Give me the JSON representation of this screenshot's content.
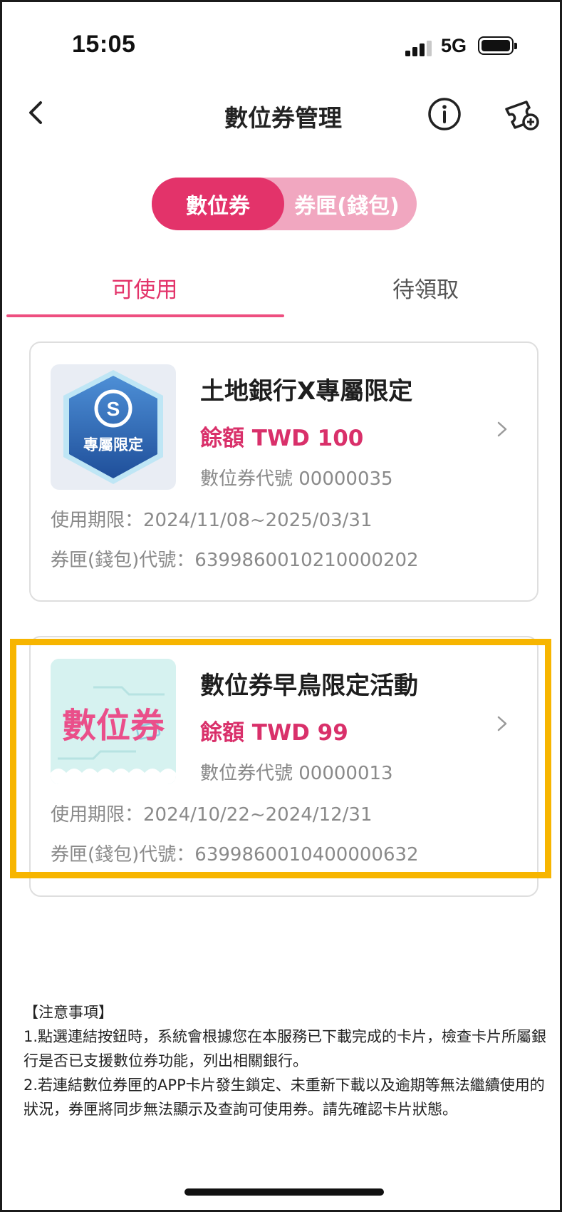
{
  "status_bar": {
    "time": "15:05",
    "network": "5G"
  },
  "nav": {
    "title": "數位券管理",
    "icons": [
      "back-icon",
      "info-icon",
      "ticket-add-icon"
    ]
  },
  "segment": {
    "active": "數位券",
    "inactive": "券匣(錢包)"
  },
  "tabs": {
    "available": "可使用",
    "pending": "待領取"
  },
  "cards": [
    {
      "title": "土地銀行X專屬限定",
      "balance": "餘額 TWD 100",
      "code": "數位券代號 00000035",
      "period": "使用期限：2024/11/08~2025/03/31",
      "wallet": "券匣(錢包)代號：6399860010210000202",
      "thumb_caption": "專屬限定",
      "thumb_letter": "S"
    },
    {
      "title": "數位券早鳥限定活動",
      "balance": "餘額 TWD 99",
      "code": "數位券代號 00000013",
      "period": "使用期限：2024/10/22~2024/12/31",
      "wallet": "券匣(錢包)代號：6399860010400000632",
      "thumb_caption": "數位券"
    }
  ],
  "notes": {
    "header": "【注意事項】",
    "items": [
      "1.點選連結按鈕時，系統會根據您在本服務已下載完成的卡片，檢查卡片所屬銀行是否已支援數位券功能，列出相關銀行。",
      "2.若連結數位券匣的APP卡片發生鎖定、未重新下載以及逾期等無法繼續使用的狀況，券匣將同步無法顯示及查詢可使用券。請先確認卡片狀態。"
    ]
  },
  "colors": {
    "accent": "#e3336a",
    "accent_light": "#f1a7c0",
    "highlight": "#f7b500"
  }
}
